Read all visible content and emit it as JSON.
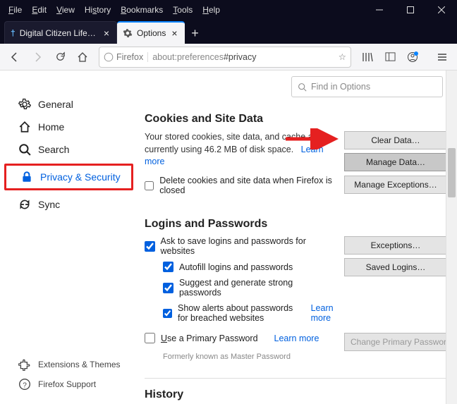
{
  "menubar": [
    "File",
    "Edit",
    "View",
    "History",
    "Bookmarks",
    "Tools",
    "Help"
  ],
  "tabs": [
    {
      "label": "Digital Citizen Life in a digital w",
      "active": false
    },
    {
      "label": "Options",
      "active": true
    }
  ],
  "url": {
    "identity": "Firefox",
    "address_base": "about:preferences",
    "address_frag": "#privacy"
  },
  "search_placeholder": "Find in Options",
  "sidebar": {
    "items": [
      {
        "label": "General"
      },
      {
        "label": "Home"
      },
      {
        "label": "Search"
      },
      {
        "label": "Privacy & Security"
      },
      {
        "label": "Sync"
      }
    ],
    "footer": [
      {
        "label": "Extensions & Themes"
      },
      {
        "label": "Firefox Support"
      }
    ]
  },
  "sections": {
    "cookies": {
      "title": "Cookies and Site Data",
      "desc_a": "Your stored cookies, site data, and cache are currently using 46.2 MB of disk space.",
      "learn": "Learn more",
      "clear": "Clear Data…",
      "manage": "Manage Data…",
      "exceptions": "Manage Exceptions…",
      "delete_close": "Delete cookies and site data when Firefox is closed"
    },
    "logins": {
      "title": "Logins and Passwords",
      "ask": "Ask to save logins and passwords for websites",
      "autofill": "Autofill logins and passwords",
      "suggest": "Suggest and generate strong passwords",
      "alerts": "Show alerts about passwords for breached websites",
      "learn": "Learn more",
      "exceptions_btn": "Exceptions…",
      "saved_btn": "Saved Logins…",
      "primary": "Use a Primary Password",
      "change_primary": "Change Primary Password…",
      "formerly": "Formerly known as Master Password"
    },
    "history_title": "History"
  }
}
